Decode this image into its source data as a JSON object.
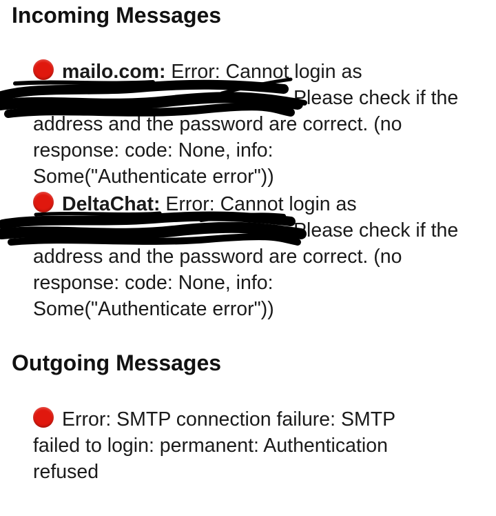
{
  "incoming": {
    "title": "Incoming Messages",
    "entries": [
      {
        "status_color": "#e0180e",
        "status_icon": "red-status-dot-icon",
        "account": "mailo.com:",
        "line1": " Error: Cannot login as",
        "line2_rest": "Please check if the",
        "line3": "address and the password are correct. (no",
        "line4": "response: code: None, info:",
        "line5": "Some(\"Authenticate error\"))"
      },
      {
        "status_color": "#e0180e",
        "status_icon": "red-status-dot-icon",
        "account": "DeltaChat:",
        "line1": " Error: Cannot login as",
        "line2_rest": "Please check if the",
        "line3": "address and the password are correct. (no",
        "line4": "response: code: None, info:",
        "line5": "Some(\"Authenticate error\"))"
      }
    ]
  },
  "outgoing": {
    "title": "Outgoing Messages",
    "entries": [
      {
        "status_color": "#e0180e",
        "status_icon": "red-status-dot-icon",
        "line1": "Error: SMTP connection failure: SMTP",
        "line2": "failed to login: permanent: Authentication",
        "line3": "refused"
      }
    ]
  }
}
